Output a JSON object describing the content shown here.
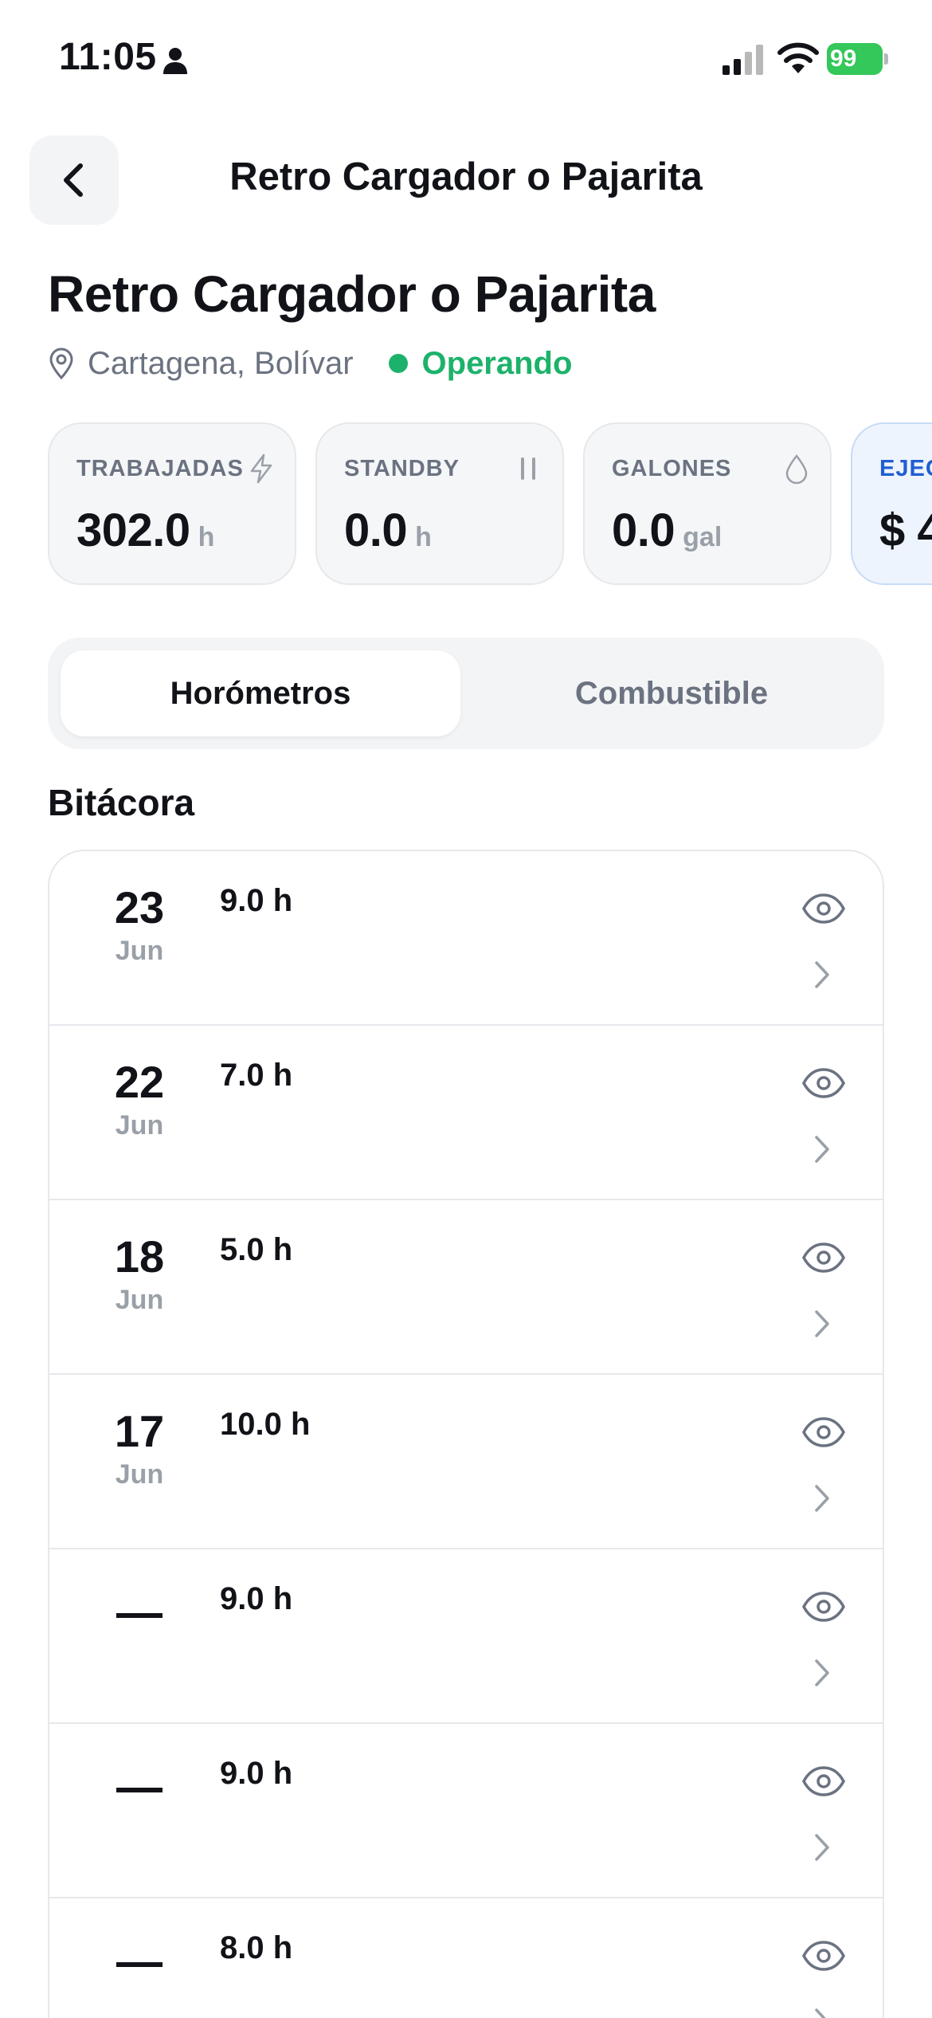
{
  "status_bar": {
    "time": "11:05",
    "battery": "99",
    "icons": [
      "person-icon",
      "signal-icon",
      "wifi-icon",
      "battery-icon"
    ]
  },
  "nav": {
    "title": "Retro Cargador o Pajarita",
    "back_icon": "chevron-left-icon"
  },
  "header": {
    "title": "Retro Cargador o Pajarita",
    "location": "Cartagena, Bolívar",
    "status": "Operando",
    "status_color": "#1db26b"
  },
  "stats": [
    {
      "label": "TRABAJADAS",
      "value": "302.0",
      "unit": "h",
      "icon": "bolt-icon"
    },
    {
      "label": "STANDBY",
      "value": "0.0",
      "unit": "h",
      "icon": "pause-icon"
    },
    {
      "label": "GALONES",
      "value": "0.0",
      "unit": "gal",
      "icon": "drop-icon"
    },
    {
      "label": "EJEC",
      "value": "$ 4",
      "unit": "",
      "icon": ""
    }
  ],
  "tabs": [
    {
      "label": "Horómetros",
      "active": true
    },
    {
      "label": "Combustible",
      "active": false
    }
  ],
  "log": {
    "title": "Bitácora",
    "entries": [
      {
        "day": "23",
        "month": "Jun",
        "hours": "9.0 h"
      },
      {
        "day": "22",
        "month": "Jun",
        "hours": "7.0 h"
      },
      {
        "day": "18",
        "month": "Jun",
        "hours": "5.0 h"
      },
      {
        "day": "17",
        "month": "Jun",
        "hours": "10.0 h"
      },
      {
        "day": "",
        "month": "",
        "hours": "9.0 h"
      },
      {
        "day": "",
        "month": "",
        "hours": "9.0 h"
      },
      {
        "day": "",
        "month": "",
        "hours": "8.0 h"
      }
    ]
  },
  "colors": {
    "accent_green": "#1db26b",
    "accent_blue": "#1f5fd1",
    "muted": "#6b7280"
  }
}
